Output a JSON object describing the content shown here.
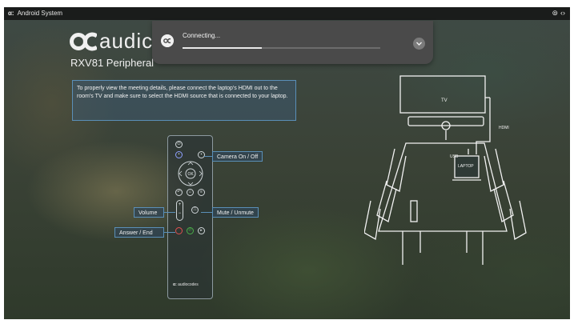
{
  "status_bar": {
    "app_name": "Android System",
    "icons": [
      "link-icon",
      "code-icon"
    ]
  },
  "brand": {
    "wordmark": "audic",
    "subtitle": "RXV81 Peripheral"
  },
  "instructions": "To properly view the meeting details, please connect the laptop's HDMI out to the room's TV and make sure to select the HDMI source that is connected to your laptop.",
  "remote": {
    "brand_text": "audiocodes",
    "callouts": {
      "camera": "Camera On / Off",
      "volume": "Volume",
      "mute": "Mute / Unmute",
      "answer": "Answer / End"
    }
  },
  "diagram": {
    "tv_label": "TV",
    "hdmi_label": "HDMI",
    "usb_label": "USB",
    "laptop_label": "LAPTOP"
  },
  "notification": {
    "title": "Connecting...",
    "progress": 0.4
  },
  "colors": {
    "accent": "#5a8fb8",
    "status_bar": "#1a1c1b",
    "notification_bg": "#4a4a4a"
  }
}
